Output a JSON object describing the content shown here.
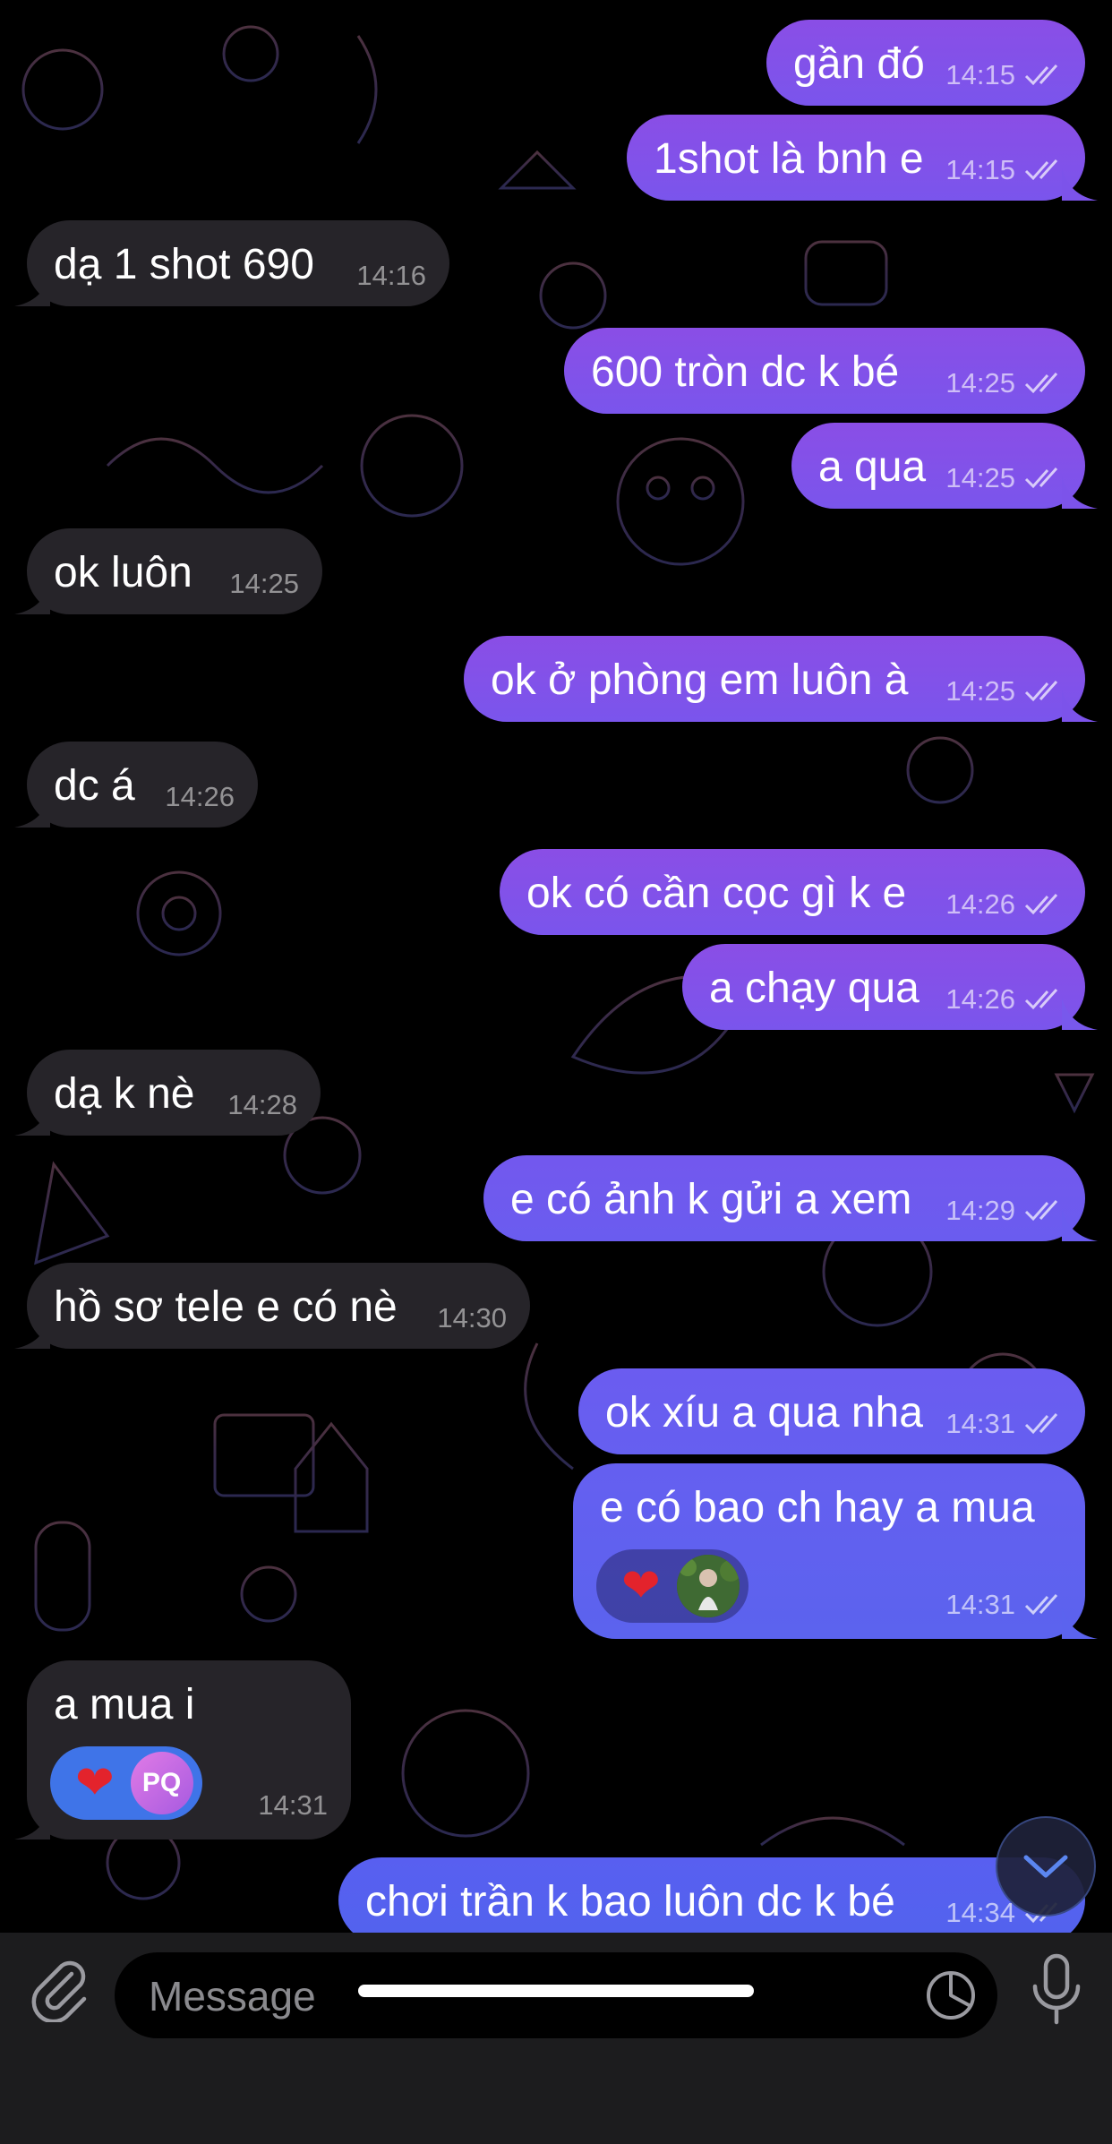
{
  "messages": [
    {
      "dir": "out",
      "text": "gần đó",
      "time": "14:15",
      "read": true
    },
    {
      "dir": "out",
      "text": "1shot là bnh e",
      "time": "14:15",
      "read": true
    },
    {
      "dir": "in",
      "text": "dạ 1 shot 690",
      "time": "14:16"
    },
    {
      "dir": "out",
      "text": "600 tròn dc k bé",
      "time": "14:25",
      "read": true
    },
    {
      "dir": "out",
      "text": "a qua",
      "time": "14:25",
      "read": true
    },
    {
      "dir": "in",
      "text": "ok luôn",
      "time": "14:25"
    },
    {
      "dir": "out",
      "text": "ok ở phòng em luôn à",
      "time": "14:25",
      "read": true
    },
    {
      "dir": "in",
      "text": "dc á",
      "time": "14:26"
    },
    {
      "dir": "out",
      "text": "ok có cần cọc gì k e",
      "time": "14:26",
      "read": true
    },
    {
      "dir": "out",
      "text": "a chạy qua",
      "time": "14:26",
      "read": true
    },
    {
      "dir": "in",
      "text": "dạ k nè",
      "time": "14:28"
    },
    {
      "dir": "out",
      "text": "e có ảnh k gửi a xem",
      "time": "14:29",
      "read": true
    },
    {
      "dir": "in",
      "text": "hồ sơ tele e có nè",
      "time": "14:30"
    },
    {
      "dir": "out",
      "text": "ok xíu a qua nha",
      "time": "14:31",
      "read": true
    },
    {
      "dir": "out",
      "text": "e có bao ch hay a mua",
      "time": "14:31",
      "read": true,
      "reaction": {
        "emoji": "❤️",
        "avatar": "photo"
      }
    },
    {
      "dir": "in",
      "text": "a mua i",
      "time": "14:31",
      "reaction": {
        "emoji": "❤️",
        "avatar_initials": "PQ"
      }
    },
    {
      "dir": "out",
      "text": "chơi trần k bao luôn dc k bé",
      "time": "14:34",
      "read": true
    }
  ],
  "input": {
    "placeholder": "Message"
  },
  "icons": {
    "attach": "paperclip-icon",
    "sticker": "sticker-icon",
    "mic": "microphone-icon",
    "scroll_down": "chevron-down-icon",
    "read": "double-check-icon"
  },
  "colors": {
    "outgoing": "#8a4ee6",
    "incoming": "#262429",
    "reaction_out": "#5b47cf",
    "reaction_in": "#3f74e8"
  }
}
